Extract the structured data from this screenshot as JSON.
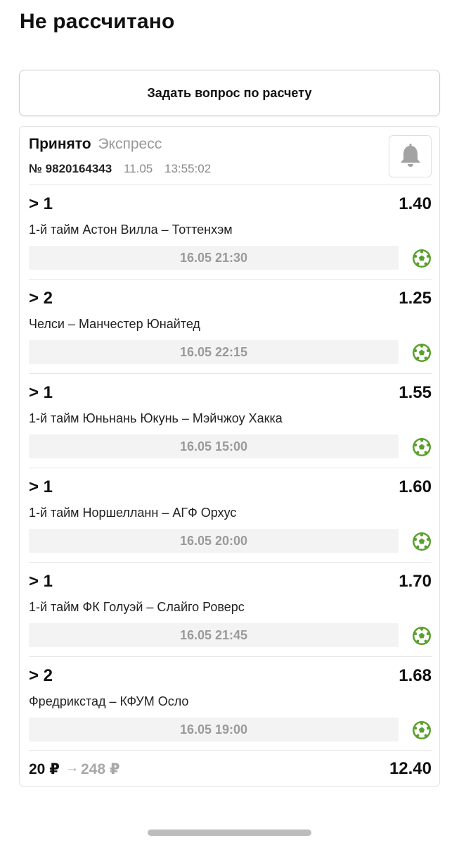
{
  "page": {
    "title": "Не рассчитано"
  },
  "ask_button": {
    "label": "Задать вопрос по расчету"
  },
  "bet": {
    "status": "Принято",
    "type": "Экспресс",
    "number": "№ 9820164343",
    "date": "11.05",
    "time": "13:55:02",
    "bell_icon": "bell-icon",
    "events": [
      {
        "outcome": "> 1",
        "odds": "1.40",
        "match": "1-й тайм Астон Вилла – Тоттенхэм",
        "start": "16.05 21:30",
        "sport_icon": "football-icon"
      },
      {
        "outcome": "> 2",
        "odds": "1.25",
        "match": "Челси – Манчестер Юнайтед",
        "start": "16.05 22:15",
        "sport_icon": "football-icon"
      },
      {
        "outcome": "> 1",
        "odds": "1.55",
        "match": "1-й тайм Юньнань Юкунь – Мэйчжоу Хакка",
        "start": "16.05 15:00",
        "sport_icon": "football-icon"
      },
      {
        "outcome": "> 1",
        "odds": "1.60",
        "match": "1-й тайм Норшелланн – АГФ Орхус",
        "start": "16.05 20:00",
        "sport_icon": "football-icon"
      },
      {
        "outcome": "> 1",
        "odds": "1.70",
        "match": "1-й тайм ФК Голуэй – Слайго Роверс",
        "start": "16.05 21:45",
        "sport_icon": "football-icon"
      },
      {
        "outcome": "> 2",
        "odds": "1.68",
        "match": "Фредрикстад – КФУМ Осло",
        "start": "16.05 19:00",
        "sport_icon": "football-icon"
      }
    ],
    "stake": "20 ₽",
    "arrow": "→",
    "payout": "248 ₽",
    "total_odds": "12.40"
  },
  "colors": {
    "accent_green": "#5aa02c",
    "muted_gray": "#9a9a9a",
    "bar_bg": "#f3f3f3"
  }
}
